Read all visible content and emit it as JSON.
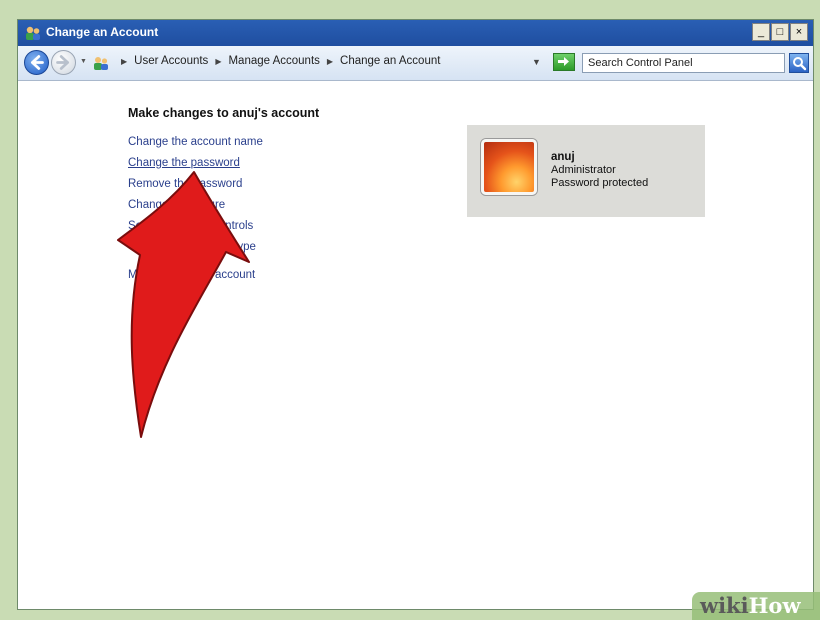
{
  "window": {
    "title": "Change an Account",
    "buttons": {
      "minimize": "_",
      "maximize": "□",
      "close": "×"
    }
  },
  "navbar": {
    "breadcrumb": [
      "User Accounts",
      "Manage Accounts",
      "Change an Account"
    ],
    "search_placeholder": "Search Control Panel"
  },
  "content": {
    "heading": "Make changes to anuj's account",
    "tasks": [
      "Change the account name",
      "Change the password",
      "Remove the password",
      "Change the picture",
      "Set up Parental Controls",
      "Change the account type",
      "Manage another account"
    ],
    "hovered_task_index": 1
  },
  "account": {
    "name": "anuj",
    "type": "Administrator",
    "status": "Password protected"
  },
  "annotation": {
    "arrow_color": "#e01b1b"
  },
  "watermark": {
    "part1": "wiki",
    "part2": "How"
  },
  "colors": {
    "titlebar": "#2a5fb4",
    "link": "#2a3f8c",
    "panel": "#dcdcd8",
    "frame": "#c9dcb4"
  }
}
